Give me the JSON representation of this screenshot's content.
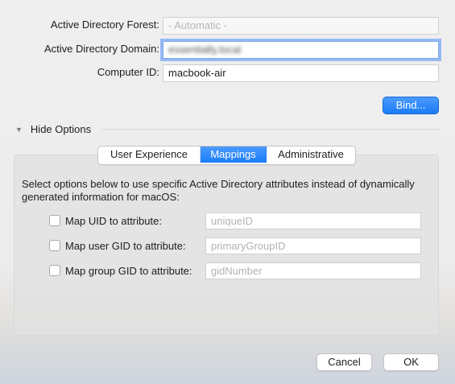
{
  "bind_form": {
    "forest_label": "Active Directory Forest:",
    "forest_placeholder": "- Automatic -",
    "domain_label": "Active Directory Domain:",
    "domain_value": "essentially.local",
    "computer_label": "Computer ID:",
    "computer_value": "macbook-air",
    "bind_button": "Bind..."
  },
  "options": {
    "disclosure_label": "Hide Options",
    "disclosure_icon": "triangle-down-icon",
    "tabs": [
      {
        "label": "User Experience",
        "selected": false
      },
      {
        "label": "Mappings",
        "selected": true
      },
      {
        "label": "Administrative",
        "selected": false
      }
    ]
  },
  "mappings": {
    "description": "Select options below to use specific Active Directory attributes instead of dynamically generated information for macOS:",
    "rows": [
      {
        "label": "Map UID to attribute:",
        "placeholder": "uniqueID",
        "checked": false
      },
      {
        "label": "Map user GID to attribute:",
        "placeholder": "primaryGroupID",
        "checked": false
      },
      {
        "label": "Map group GID to attribute:",
        "placeholder": "gidNumber",
        "checked": false
      }
    ]
  },
  "footer": {
    "cancel_label": "Cancel",
    "ok_label": "OK"
  },
  "colors": {
    "accent": "#1a7cf5",
    "focus_ring": "#4d90fe"
  }
}
